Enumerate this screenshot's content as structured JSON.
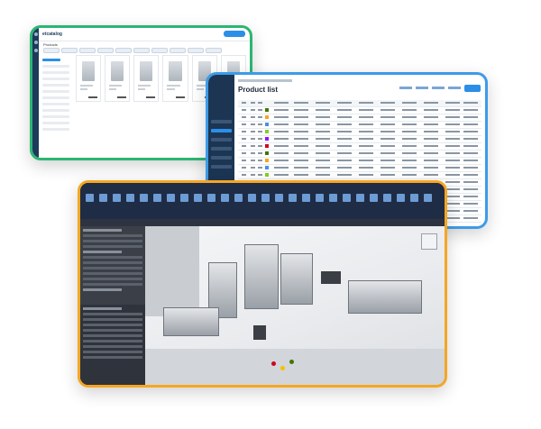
{
  "catalog_window": {
    "brand": "etcatalog",
    "section_title": "Products",
    "colors": {
      "frame": "#2bb673",
      "sidebar": "#1d3a5a",
      "accent": "#2b8fe8"
    }
  },
  "product_list_window": {
    "title": "Product list",
    "colors": {
      "frame": "#3d9be9",
      "sidebar": "#1c3553",
      "accent": "#2b8fe8"
    }
  },
  "cad_window": {
    "colors": {
      "frame": "#f5a623",
      "ribbon": "#1e2c45",
      "panel": "#3a3f48"
    }
  }
}
